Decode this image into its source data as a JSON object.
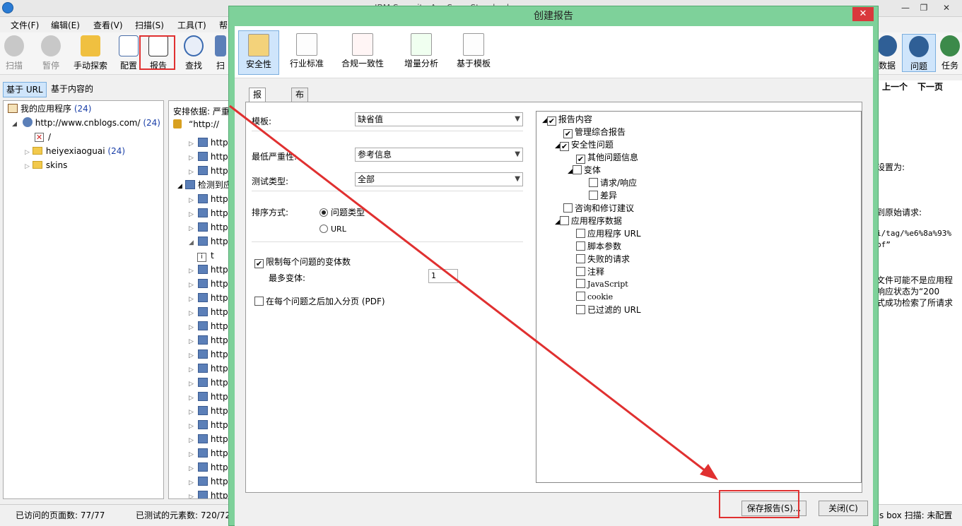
{
  "window": {
    "title": "IBM Security AppScan Standard",
    "min": "—",
    "restore": "❐",
    "close": "✕"
  },
  "menu": [
    "文件(F)",
    "编辑(E)",
    "查看(V)",
    "扫描(S)",
    "工具(T)",
    "帮"
  ],
  "toolbar": {
    "left": [
      {
        "label": "扫描",
        "icon": "play-icon"
      },
      {
        "label": "暂停",
        "icon": "pause-icon"
      },
      {
        "label": "手动探索",
        "icon": "hand-icon"
      },
      {
        "label": "配置",
        "icon": "checklist-icon"
      },
      {
        "label": "报告",
        "icon": "report-icon"
      },
      {
        "label": "查找",
        "icon": "magnifier-icon"
      },
      {
        "label": "扫",
        "icon": "scan-icon"
      }
    ],
    "right": [
      {
        "label": "数据",
        "icon": "data-icon"
      },
      {
        "label": "问题",
        "icon": "lock-icon"
      },
      {
        "label": "任务",
        "icon": "check-icon"
      }
    ]
  },
  "scope": {
    "url_tab": "基于 URL",
    "content_tab": "基于内容的"
  },
  "nav": {
    "prev": "上一个",
    "next": "下一页"
  },
  "tree": {
    "root": {
      "label": "我的应用程序",
      "count": "(24)"
    },
    "site": {
      "label": "http://www.cnblogs.com/",
      "count": "(24)"
    },
    "slash": "/",
    "folder1": {
      "label": "heiyexiaoguai",
      "count": "(24)"
    },
    "folder2": "skins"
  },
  "middle": {
    "header": "安排依据: 严重",
    "quoted": "“http://",
    "group": "检测到应",
    "info_row": "t",
    "row_label": "http"
  },
  "right_panel": {
    "l1": "设置为:",
    "l2": "到原始请求:",
    "l3": "i/tag/%e6%8a%93%",
    "l4": "bf”",
    "l5": "文件可能不是应用程",
    "l6": "响应状态为“200",
    "l7": "式成功检索了所请求"
  },
  "status": {
    "visited": "已访问的页面数: 77/77",
    "tested": "已测试的元素数: 720/72",
    "right": "s box  扫描: 未配置"
  },
  "dialog": {
    "title": "创建报告",
    "close": "✕",
    "categories": [
      "安全性",
      "行业标准",
      "合规一致性",
      "增量分析",
      "基于模板"
    ],
    "tabs": [
      "报告类型",
      "布局"
    ],
    "template_label": "模板:",
    "template_value": "缺省值",
    "severity_label": "最低严重性:",
    "severity_value": "参考信息",
    "test_type_label": "测试类型:",
    "test_type_value": "全部",
    "sort_label": "排序方式:",
    "sort_issue": "问题类型",
    "sort_url": "URL",
    "limit_label": "限制每个问题的变体数",
    "max_variants_label": "最多变体:",
    "max_variants_value": "1",
    "page_break_label": "在每个问题之后加入分页 (PDF)",
    "tree": {
      "root": "报告内容",
      "summary": "管理综合报告",
      "security": "安全性问题",
      "other_info": "其他问题信息",
      "variants": "变体",
      "req_resp": "请求/响应",
      "diff": "差异",
      "advisory": "咨询和修订建议",
      "app_data": "应用程序数据",
      "app_url": "应用程序 URL",
      "script_params": "脚本参数",
      "failed_req": "失败的请求",
      "comments": "注释",
      "javascript": "JavaScript",
      "cookie": "cookie",
      "filtered_url": "已过滤的 URL"
    },
    "save_button": "保存报告(S)...",
    "close_button": "关闭(C)"
  },
  "colors": {
    "dialog_frame": "#7ed19a",
    "highlight": "#e03030",
    "active_cat": "#cfe5fb"
  }
}
